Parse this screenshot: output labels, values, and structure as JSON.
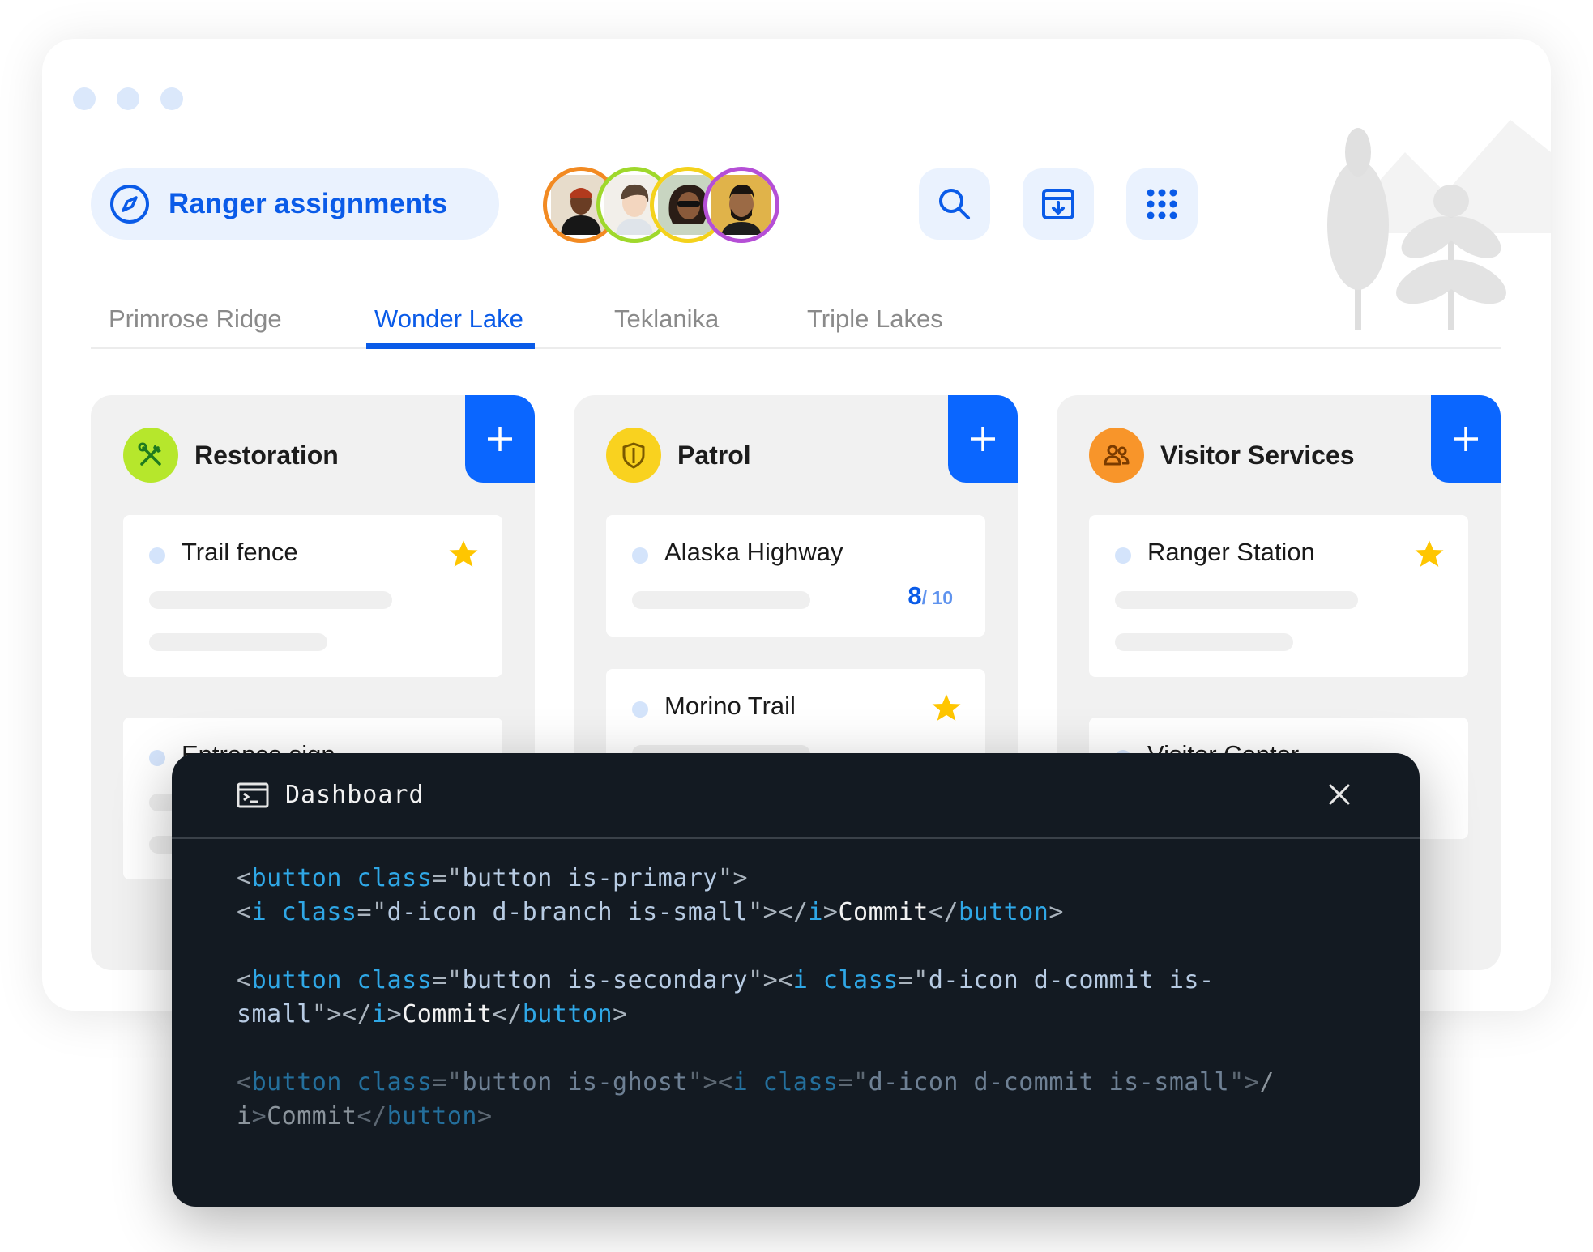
{
  "header": {
    "title": "Ranger assignments",
    "avatars": [
      {
        "name": "avatar-1",
        "ring_color": "#f28a22"
      },
      {
        "name": "avatar-2",
        "ring_color": "#9fd82c"
      },
      {
        "name": "avatar-3",
        "ring_color": "#f4d21c"
      },
      {
        "name": "avatar-4",
        "ring_color": "#b54fd6"
      }
    ],
    "icons": [
      "search-icon",
      "archive-download-icon",
      "apps-grid-icon"
    ]
  },
  "tabs": [
    {
      "label": "Primrose Ridge",
      "active": false
    },
    {
      "label": "Wonder Lake",
      "active": true
    },
    {
      "label": "Teklanika",
      "active": false
    },
    {
      "label": "Triple Lakes",
      "active": false
    }
  ],
  "columns": [
    {
      "title": "Restoration",
      "icon": "tools-icon",
      "icon_bg": "#b6e72c",
      "cards": [
        {
          "title": "Trail fence",
          "starred": true
        },
        {
          "title": "Entrance sign",
          "starred": false
        }
      ]
    },
    {
      "title": "Patrol",
      "icon": "shield-icon",
      "icon_bg": "#f9d21f",
      "cards": [
        {
          "title": "Alaska Highway",
          "count": "8",
          "total": "/ 10"
        },
        {
          "title": "Morino Trail",
          "starred": true
        }
      ]
    },
    {
      "title": "Visitor Services",
      "icon": "people-icon",
      "icon_bg": "#f8952a",
      "cards": [
        {
          "title": "Ranger Station",
          "starred": true
        },
        {
          "title": "Visitor Center",
          "starred": false
        }
      ]
    }
  ],
  "dashboard": {
    "title": "Dashboard",
    "code": [
      "<button class=\"button is-primary\">\n<i class=\"d-icon d-branch is-small\"></i>Commit</button>",
      "<button class=\"button is-secondary\"><i class=\"d-icon d-commit is-\nsmall\"></i>Commit</button>",
      "<button class=\"button is-ghost\"><i class=\"d-icon d-commit is-small\"></\ni>Commit</button>"
    ]
  },
  "colors": {
    "accent": "#0a5be8",
    "add_button": "#0a66ff",
    "star": "#ffc600",
    "terminal_bg": "#131a22"
  }
}
